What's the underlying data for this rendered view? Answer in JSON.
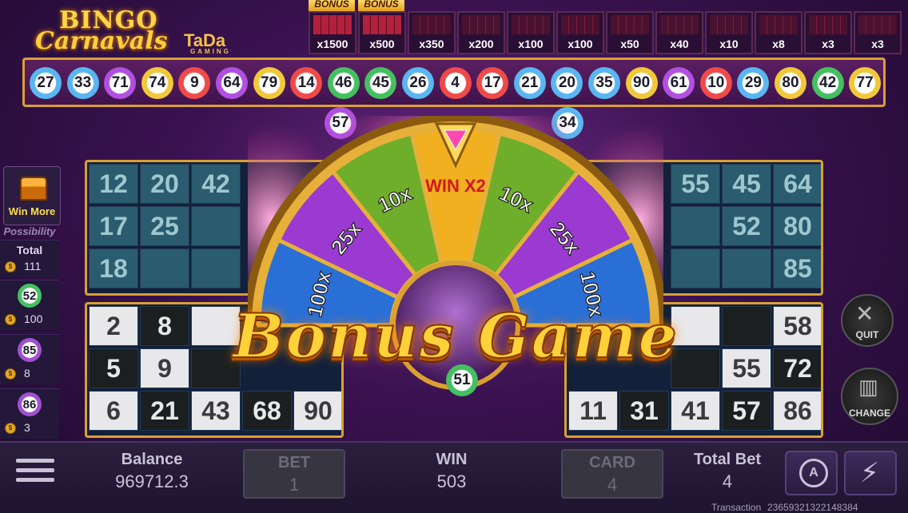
{
  "logo": {
    "line1": "BINGO",
    "line2": "Carnavals",
    "brand": "TaDa",
    "brand_sub": "GAMING"
  },
  "paytable": [
    {
      "bonus": "BONUS",
      "multiplier": "x1500",
      "highlight": true
    },
    {
      "bonus": "BONUS",
      "multiplier": "x500",
      "highlight": true
    },
    {
      "bonus": "",
      "multiplier": "x350",
      "highlight": false
    },
    {
      "bonus": "",
      "multiplier": "x200",
      "highlight": false
    },
    {
      "bonus": "",
      "multiplier": "x100",
      "highlight": false
    },
    {
      "bonus": "",
      "multiplier": "x100",
      "highlight": false
    },
    {
      "bonus": "",
      "multiplier": "x50",
      "highlight": false
    },
    {
      "bonus": "",
      "multiplier": "x40",
      "highlight": false
    },
    {
      "bonus": "",
      "multiplier": "x10",
      "highlight": false
    },
    {
      "bonus": "",
      "multiplier": "x8",
      "highlight": false
    },
    {
      "bonus": "",
      "multiplier": "x3",
      "highlight": false
    },
    {
      "bonus": "",
      "multiplier": "x3",
      "highlight": false
    }
  ],
  "drawn_balls": [
    {
      "n": "27",
      "color": "blue"
    },
    {
      "n": "33",
      "color": "blue"
    },
    {
      "n": "71",
      "color": "purple"
    },
    {
      "n": "74",
      "color": "yellow"
    },
    {
      "n": "9",
      "color": "red"
    },
    {
      "n": "64",
      "color": "purple"
    },
    {
      "n": "79",
      "color": "yellow"
    },
    {
      "n": "14",
      "color": "red"
    },
    {
      "n": "46",
      "color": "green"
    },
    {
      "n": "45",
      "color": "green"
    },
    {
      "n": "26",
      "color": "blue"
    },
    {
      "n": "4",
      "color": "red"
    },
    {
      "n": "17",
      "color": "red"
    },
    {
      "n": "21",
      "color": "blue"
    },
    {
      "n": "20",
      "color": "blue"
    },
    {
      "n": "35",
      "color": "blue"
    },
    {
      "n": "90",
      "color": "yellow"
    },
    {
      "n": "61",
      "color": "purple"
    },
    {
      "n": "10",
      "color": "red"
    },
    {
      "n": "29",
      "color": "blue"
    },
    {
      "n": "80",
      "color": "yellow"
    },
    {
      "n": "42",
      "color": "green"
    },
    {
      "n": "77",
      "color": "yellow"
    }
  ],
  "extra_balls": [
    "57",
    "34"
  ],
  "left_panel": {
    "win_more": "Win More",
    "possibility": "Possibility",
    "total_label": "Total",
    "total_value": "111",
    "rows": [
      {
        "ball": "52",
        "value": "100"
      },
      {
        "ball": "85",
        "value": "8"
      },
      {
        "ball": "86",
        "value": "3"
      }
    ]
  },
  "cards": {
    "tl": [
      [
        "12",
        "20",
        "42"
      ],
      [
        "17",
        "25",
        ""
      ],
      [
        "18",
        "",
        ""
      ]
    ],
    "tr": [
      [
        "55",
        "45",
        "64"
      ],
      [
        "",
        "52",
        "80"
      ],
      [
        "",
        "",
        "85"
      ]
    ],
    "bl": [
      [
        "2",
        "8",
        ""
      ],
      [
        "5",
        "9",
        ""
      ],
      [
        "6",
        "21",
        "43",
        "68",
        "90"
      ]
    ],
    "br": [
      [
        "",
        "",
        "58"
      ],
      [
        "",
        "55",
        "72"
      ],
      [
        "11",
        "31",
        "41",
        "57",
        "86"
      ]
    ]
  },
  "wheel": {
    "segments": [
      "100x",
      "25x",
      "10x",
      "WIN X2",
      "10x",
      "25x",
      "100x"
    ],
    "center_ball": "51"
  },
  "bonus_title": "Bonus Game",
  "right_buttons": {
    "quit": "QUIT",
    "change": "CHANGE"
  },
  "bottom": {
    "balance_label": "Balance",
    "balance_value": "969712.3",
    "bet_label": "BET",
    "bet_value": "1",
    "win_label": "WIN",
    "win_value": "503",
    "card_label": "CARD",
    "card_value": "4",
    "total_bet_label": "Total Bet",
    "total_bet_value": "4",
    "transaction_label": "Transaction",
    "transaction_value": "23659321322148384"
  },
  "colors": {
    "gold": "#d9a032",
    "bg": "#3a1250",
    "title": "#ffd23a"
  }
}
